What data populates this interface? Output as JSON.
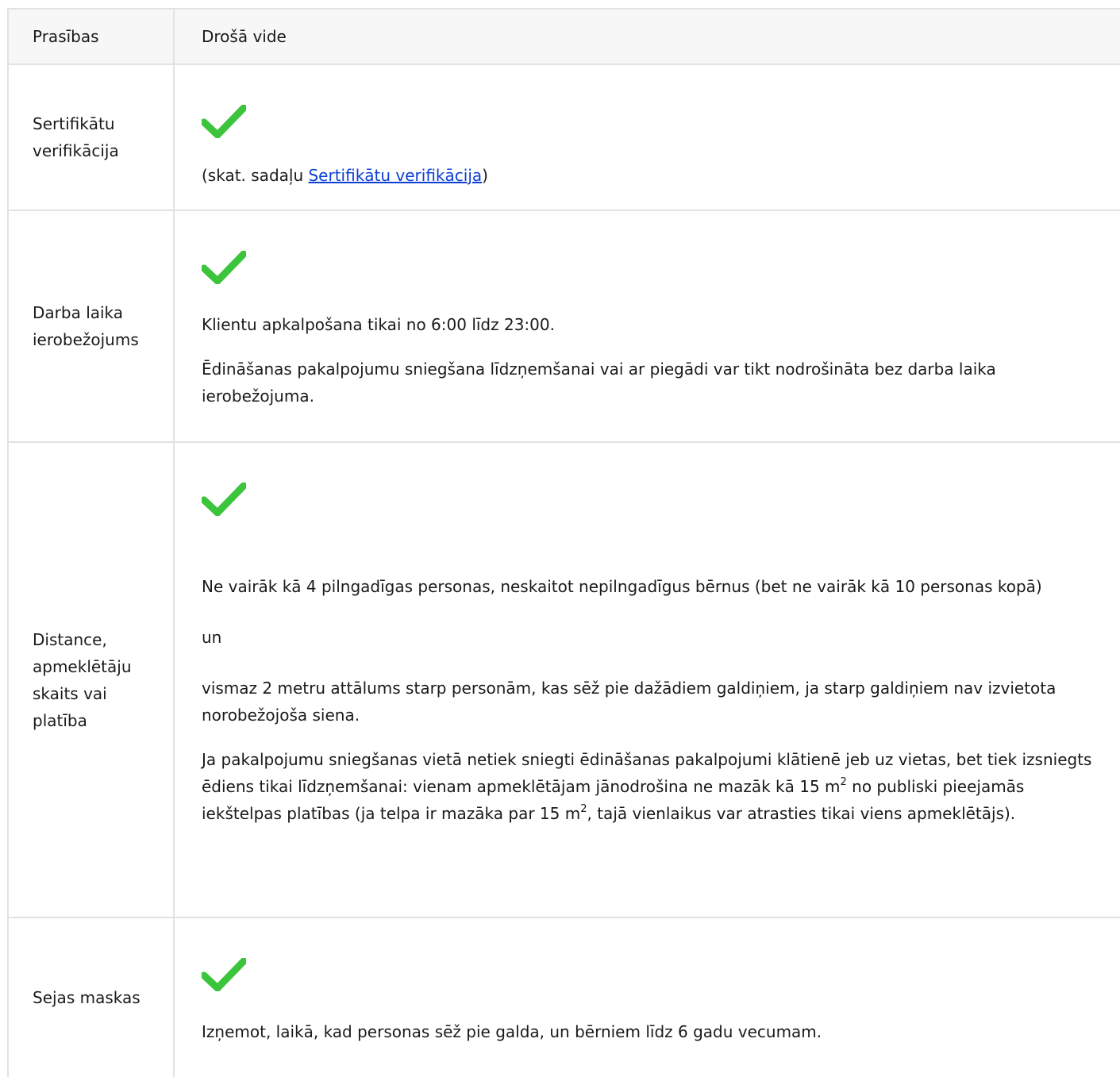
{
  "header": {
    "col1": "Prasības",
    "col2": "Drošā vide"
  },
  "rows": [
    {
      "label": "Sertifikātu verifikācija",
      "note_prefix": "(skat. sadaļu ",
      "note_link": "Sertifikātu verifikācija",
      "note_suffix": ")"
    },
    {
      "label": "Darba laika ierobežojums",
      "p1": "Klientu apkalpošana tikai no 6:00 līdz 23:00.",
      "p2": "Ēdināšanas pakalpojumu sniegšana līdzņemšanai vai ar piegādi var tikt nodrošināta bez darba laika ierobežojuma."
    },
    {
      "label": "Distance, apmeklētāju skaits vai platība",
      "p1": "Ne vairāk kā 4 pilngadīgas personas, neskaitot nepilngadīgus bērnus (bet ne vairāk kā 10 personas kopā)",
      "p2": "un",
      "p3": "vismaz 2 metru attālums starp personām, kas sēž pie dažādiem galdiņiem, ja starp galdiņiem nav izvietota norobežojoša siena.",
      "p4_a": "Ja pakalpojumu sniegšanas vietā netiek sniegti ēdināšanas pakalpojumi klātienē jeb uz vietas, bet tiek izsniegts ēdiens tikai līdzņemšanai: vienam apmeklētājam jānodrošina ne mazāk kā 15 m",
      "p4_sup1": "2",
      "p4_b": " no publiski pieejamās iekštelpas platības (ja telpa ir mazāka par 15 m",
      "p4_sup2": "2",
      "p4_c": ", tajā vienlaikus var atrasties tikai viens apmeklētājs)."
    },
    {
      "label": "Sejas maskas",
      "p1": "Izņemot, laikā, kad personas sēž pie galda, un bērniem līdz 6 gadu vecumam."
    }
  ],
  "icons": {
    "check": "checkmark-icon",
    "check_color": "#3cc43c"
  }
}
